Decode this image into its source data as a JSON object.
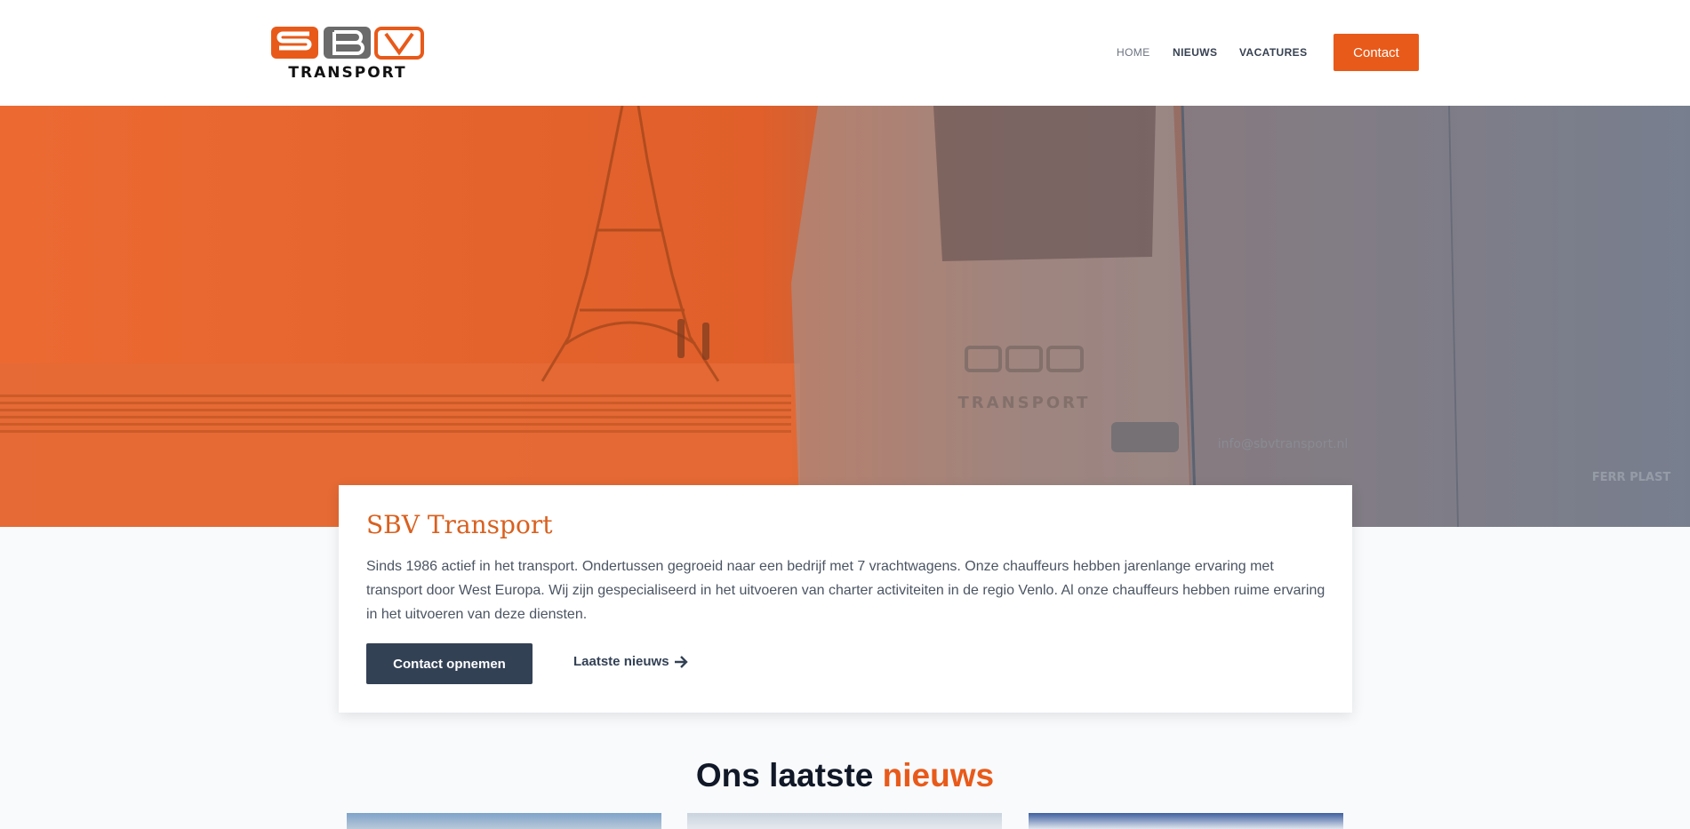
{
  "brand": {
    "logo_letters": "SBV",
    "logo_word": "TRANSPORT",
    "accent_color": "#e85a1a",
    "dark_color": "#334155"
  },
  "nav": {
    "items": [
      {
        "label": "HOME",
        "active": true
      },
      {
        "label": "NIEUWS",
        "active": false
      },
      {
        "label": "VACATURES",
        "active": false
      }
    ],
    "contact_label": "Contact"
  },
  "hero": {
    "truck_email": "info@sbvtransport.nl",
    "trailer_brand": "FERR PLAST"
  },
  "intro": {
    "title": "SBV Transport",
    "text": "Sinds 1986 actief in het transport. Ondertussen gegroeid naar een bedrijf met 7 vrachtwagens. Onze chauffeurs hebben jarenlange ervaring met transport door West Europa. Wij zijn gespecialiseerd in het uitvoeren van charter activiteiten in de regio Venlo. Al onze chauffeurs hebben ruime ervaring in het uitvoeren van deze diensten.",
    "primary_button": "Contact opnemen",
    "secondary_link": "Laatste nieuws",
    "secondary_icon": "arrow-right-icon"
  },
  "news": {
    "heading_prefix": "Ons laatste ",
    "heading_accent": "nieuws"
  }
}
